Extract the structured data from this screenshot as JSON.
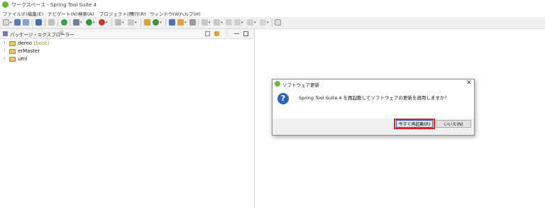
{
  "window": {
    "title": "ワークスペース - Spring Tool Suite 4"
  },
  "menu": [
    "ファイル(F)",
    "編集(E)",
    "ナビゲート(N)",
    "検索(A)",
    "プロジェクト(P)",
    "実行(R)",
    "ウィンドウ(W)",
    "ヘルプ(H)"
  ],
  "package_explorer": {
    "title": "パッケージ・エクスプローラー",
    "close_mark": "☒",
    "items": [
      {
        "label": "demo",
        "decoration": "[boot]"
      },
      {
        "label": "erMaster",
        "decoration": ""
      },
      {
        "label": "uml",
        "decoration": ""
      }
    ]
  },
  "dialog": {
    "title": "ソフトウェア更新",
    "message": "Spring Tool Suite 4 を再起動してソフトウェアの更新を適用しますか?",
    "restart_label": "今すぐ再起動(R)",
    "no_label": "いいえ(N)",
    "close_glyph": "✕",
    "icon_glyph": "?"
  },
  "colors": {
    "spring_green": "#6db33f",
    "question_blue": "#2e63b8",
    "highlight_red": "#d6262a"
  }
}
